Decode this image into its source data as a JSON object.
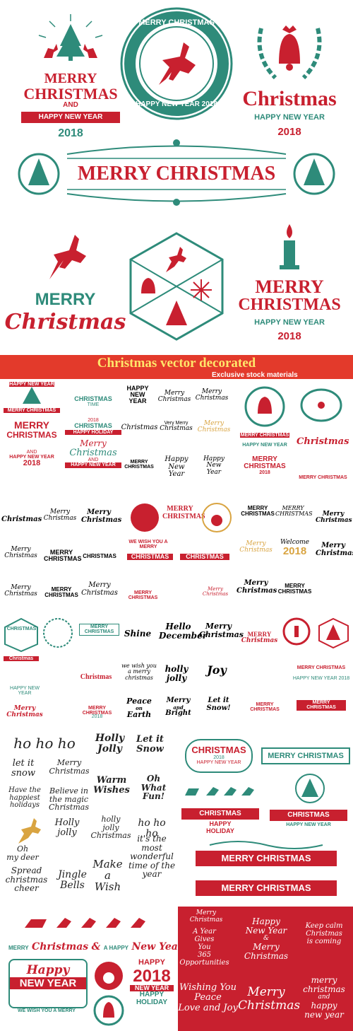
{
  "top": {
    "badge1": {
      "line1": "MERRY",
      "line2": "CHRISTMAS",
      "and": "AND",
      "ribbon": "HAPPY NEW YEAR",
      "year": "2018"
    },
    "badge2": {
      "ring_top": "MERRY CHRISTMAS",
      "ring_bottom": "HAPPY NEW YEAR 2018"
    },
    "badge3": {
      "word": "Christmas",
      "sub": "HAPPY NEW YEAR",
      "year": "2018"
    },
    "frame": {
      "text": "MERRY CHRISTMAS"
    },
    "badge4": {
      "line1": "MERRY",
      "line2": "Christmas"
    },
    "badge6": {
      "line1": "MERRY",
      "line2": "CHRISTMAS",
      "sub": "HAPPY NEW YEAR",
      "year": "2018"
    }
  },
  "banner": {
    "title": "Christmas vector decorated",
    "subtitle": "Exclusive stock materials"
  },
  "grid1": {
    "a": {
      "ribbon": "HAPPY NEW YEAR",
      "title": "MERRY CHRISTMAS",
      "merry": "MERRY",
      "christmas": "CHRISTMAS",
      "and": "AND",
      "hny": "HAPPY NEW YEAR",
      "year": "2018"
    },
    "b": {
      "t1": "CHRISTMAS",
      "t2": "TIME",
      "t3": "2018",
      "t4": "CHRISTMAS",
      "t5": "HAPPY HOLIDAY",
      "t6": "Merry",
      "t7": "Christmas",
      "t8": "AND",
      "t9": "HAPPY NEW YEAR"
    },
    "c": {
      "t1": "HAPPY",
      "t2": "NEW",
      "t3": "YEAR",
      "t4": "Merry",
      "t5": "Christmas",
      "t6": "Merry",
      "t7": "Christmas",
      "t8": "Christmas",
      "t9": "Very Merry",
      "t10": "Christmas",
      "t11": "Merry",
      "t12": "Christmas",
      "t13": "MERRY",
      "t14": "CHRISTMAS",
      "t15": "Happy",
      "t16": "New",
      "t17": "Year",
      "t18": "Happy",
      "t19": "New",
      "t20": "Year"
    },
    "d": {
      "t1": "MERRY CHRISTMAS",
      "t2": "HAPPY NEW YEAR",
      "t3": "Christmas",
      "t4": "MERRY",
      "t5": "CHRISTMAS",
      "t6": "2018",
      "t7": "MERRY CHRISTMAS"
    }
  },
  "grid2": {
    "a": {
      "t1": "Christmas",
      "t2": "Merry",
      "t3": "Christmas",
      "t4": "Merry",
      "t5": "Christmas",
      "t6": "Merry",
      "t7": "Christmas",
      "t8": "MERRY",
      "t9": "CHRISTMAS",
      "t10": "CHRISTMAS",
      "t11": "Merry",
      "t12": "Christmas",
      "t13": "MERRY",
      "t14": "CHRISTMAS",
      "t15": "Merry",
      "t16": "Christmas"
    },
    "b": {
      "t1": "MERRY",
      "t2": "CHRISTMAS",
      "t3": "WE WISH YOU A MERRY",
      "t4": "CHRISTMAS",
      "t5": "CHRISTMAS",
      "t6": "MERRY CHRISTMAS",
      "t7": "Merry",
      "t8": "Christmas"
    },
    "c": {
      "t1": "MERRY",
      "t2": "CHRISTMAS",
      "t3": "MERRY",
      "t4": "CHRISTMAS",
      "t5": "Welcome",
      "t6": "2018",
      "t7": "Merry",
      "t8": "Christmas",
      "t9": "Merry",
      "t10": "Christmas",
      "t11": "MERRY",
      "t12": "CHRISTMAS",
      "t13": "Merry",
      "t14": "Christmas",
      "t15": "Merry",
      "t16": "Christmas"
    }
  },
  "grid3": {
    "a": {
      "t1": "CHRISTMAS",
      "t2": "MERRY",
      "t3": "CHRISTMAS",
      "t4": "Christmas",
      "t5": "Christmas",
      "t6": "Merry Christmas",
      "t7": "MERRY CHRISTMAS",
      "t8": "2018",
      "t9": "HAPPY NEW YEAR"
    },
    "b": {
      "t1": "Shine",
      "t2": "Hello",
      "t3": "December",
      "t4": "Merry",
      "t5": "Christmas",
      "t6": "we wish you a merry christmas",
      "t7": "holly",
      "t8": "jolly",
      "t9": "Joy",
      "t10": "Peace",
      "t11": "on",
      "t12": "Earth",
      "t13": "Merry",
      "t14": "and",
      "t15": "Bright",
      "t16": "Let it",
      "t17": "Snow!"
    },
    "c": {
      "t1": "MERRY",
      "t2": "Christmas",
      "t3": "MERRY CHRISTMAS",
      "t4": "HAPPY NEW YEAR 2018",
      "t5": "MERRY",
      "t6": "CHRISTMAS",
      "t7": "MERRY",
      "t8": "CHRISTMAS"
    }
  },
  "lettering": {
    "t1": "ho ho ho",
    "t2": "Holly",
    "t3": "Jolly",
    "t4": "Let it",
    "t5": "Snow",
    "t6": "let it",
    "t7": "snow",
    "t8": "Merry",
    "t9": "Christmas",
    "t10": "Warm",
    "t11": "Wishes",
    "t12": "Oh",
    "t13": "What",
    "t14": "Fun!",
    "t15": "Have the",
    "t16": "happiest",
    "t17": "holidays",
    "t18": "Believe in",
    "t19": "the magic",
    "t20": "Christmas",
    "t21": "Holly",
    "t22": "jolly",
    "t23": "holly",
    "t24": "jolly",
    "t25": "Christmas",
    "t26": "ho ho ho",
    "t27": "Oh",
    "t28": "my deer",
    "t29": "it's the",
    "t30": "most",
    "t31": "wonderful",
    "t32": "time of the",
    "t33": "year",
    "t34": "Spread",
    "t35": "christmas",
    "t36": "cheer",
    "t37": "Jingle",
    "t38": "Bells",
    "t39": "Make",
    "t40": "a",
    "t41": "Wish"
  },
  "labels_right": {
    "t1": "CHRISTMAS",
    "t2": "2018",
    "t3": "HAPPY NEW YEAR",
    "t4": "MERRY CHRISTMAS",
    "t5": "CHRISTMAS",
    "t6": "HAPPY",
    "t7": "HOLIDAY",
    "t8": "CHRISTMAS",
    "t9": "HAPPY NEW YEAR",
    "t10": "MERRY CHRISTMAS",
    "t11": "MERRY CHRISTMAS"
  },
  "bottom_left": {
    "merry": "MERRY",
    "christmas": "Christmas",
    "amp": "&",
    "a_happy": "A HAPPY",
    "new_year": "New Year",
    "happy": "Happy",
    "ny": "NEW YEAR",
    "wish": "WE WISH YOU A MERRY",
    "happy2": "HAPPY",
    "year2018": "2018",
    "ny2": "NEW YEAR",
    "happy3": "HAPPY",
    "holiday": "HOLIDAY"
  },
  "red_panel": {
    "t1": "Merry",
    "t2": "Christmas",
    "t3": "A Year",
    "t4": "Gives",
    "t5": "You",
    "t6": "365",
    "t7": "Opportunities",
    "t8": "Happy",
    "t9": "New Year",
    "t10": "&",
    "t11": "Merry",
    "t12": "Christmas",
    "t13": "Keep calm",
    "t14": "Christmas",
    "t15": "is coming",
    "t16": "Wishing You",
    "t17": "Peace",
    "t18": "Love and Joy",
    "t19": "Merry",
    "t20": "Christmas",
    "t21": "merry",
    "t22": "christmas",
    "t23": "and",
    "t24": "happy",
    "t25": "new year"
  },
  "colors": {
    "red": "#c8202f",
    "teal": "#2e8b7a",
    "gold": "#d9a441",
    "banner": "#e33a2b",
    "banner_text": "#ffe66a"
  }
}
